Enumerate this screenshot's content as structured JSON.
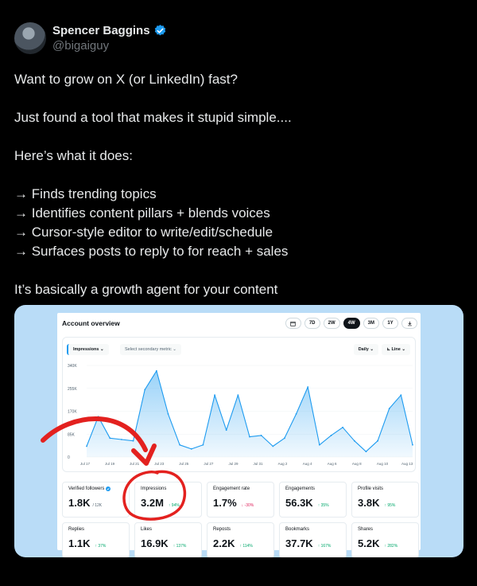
{
  "author": {
    "name": "Spencer Baggins",
    "handle": "@bigaiguy"
  },
  "tweet": {
    "line1": "Want to grow on X (or LinkedIn) fast?",
    "line2": "Just found a tool that makes it stupid simple....",
    "line3": "Here’s what it does:",
    "bullet1": "→ Finds trending topics",
    "bullet2": "→ Identifies content pillars + blends voices",
    "bullet3": "→ Cursor-style editor to write/edit/schedule",
    "bullet4": "→ Surfaces posts to reply to for reach + sales",
    "line4": "It’s basically a growth agent for your content"
  },
  "dashboard": {
    "title": "Account overview",
    "ranges": [
      "7D",
      "2W",
      "4W",
      "3M",
      "1Y"
    ],
    "active_range": "4W",
    "primary_metric": "Impressions",
    "secondary_metric": "Select secondary metric",
    "frequency": "Daily",
    "chart_type": "Line"
  },
  "chart_data": {
    "type": "area",
    "yticks": [
      "340K",
      "255K",
      "170K",
      "85K",
      "0"
    ],
    "ylim": [
      0,
      340000
    ],
    "xticks": [
      "Jul 17",
      "Jul 19",
      "Jul 21",
      "Jul 23",
      "Jul 25",
      "Jul 27",
      "Jul 29",
      "Jul 31",
      "Aug 2",
      "Aug 4",
      "Aug 6",
      "Aug 8",
      "Aug 10",
      "Aug 13"
    ],
    "values": [
      40000,
      150000,
      70000,
      65000,
      60000,
      250000,
      320000,
      160000,
      45000,
      30000,
      45000,
      230000,
      100000,
      230000,
      75000,
      80000,
      40000,
      70000,
      160000,
      260000,
      45000,
      80000,
      110000,
      60000,
      20000,
      60000,
      180000,
      230000,
      45000
    ],
    "color": "#1d9bf0"
  },
  "stats": [
    {
      "label": "Verified followers",
      "value": "1.8K",
      "sub": "/ 12K",
      "delta": "",
      "verified": true
    },
    {
      "label": "Impressions",
      "value": "3.2M",
      "sub": "",
      "delta": "↑ 94%"
    },
    {
      "label": "Engagement rate",
      "value": "1.7%",
      "sub": "",
      "delta": "↓ -30%",
      "down": true
    },
    {
      "label": "Engagements",
      "value": "56.3K",
      "sub": "",
      "delta": "↑ 35%"
    },
    {
      "label": "Profile visits",
      "value": "3.8K",
      "sub": "",
      "delta": "↑ 95%"
    },
    {
      "label": "Replies",
      "value": "1.1K",
      "sub": "",
      "delta": "↑ 37%"
    },
    {
      "label": "Likes",
      "value": "16.9K",
      "sub": "",
      "delta": "↑ 137%"
    },
    {
      "label": "Reposts",
      "value": "2.2K",
      "sub": "",
      "delta": "↑ 114%"
    },
    {
      "label": "Bookmarks",
      "value": "37.7K",
      "sub": "",
      "delta": "↑ 167%"
    },
    {
      "label": "Shares",
      "value": "5.2K",
      "sub": "",
      "delta": "↑ 282%"
    }
  ],
  "colors": {
    "annotation": "#e3211f",
    "accent": "#1d9bf0",
    "media_bg": "#b9dcf7"
  }
}
